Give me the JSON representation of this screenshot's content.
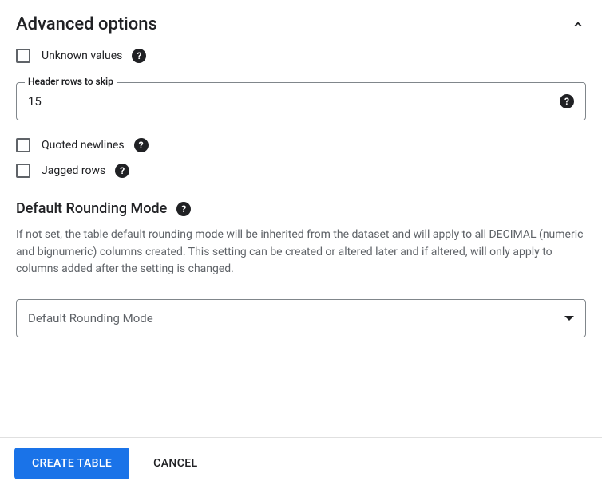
{
  "section": {
    "title": "Advanced options"
  },
  "options": {
    "unknown_values_label": "Unknown values",
    "quoted_newlines_label": "Quoted newlines",
    "jagged_rows_label": "Jagged rows"
  },
  "header_rows": {
    "label": "Header rows to skip",
    "value": "15"
  },
  "rounding": {
    "title": "Default Rounding Mode",
    "description": "If not set, the table default rounding mode will be inherited from the dataset and will apply to all DECIMAL (numeric and bignumeric) columns created. This setting can be created or altered later and if altered, will only apply to columns added after the setting is changed.",
    "select_placeholder": "Default Rounding Mode"
  },
  "footer": {
    "create_label": "CREATE TABLE",
    "cancel_label": "CANCEL"
  }
}
